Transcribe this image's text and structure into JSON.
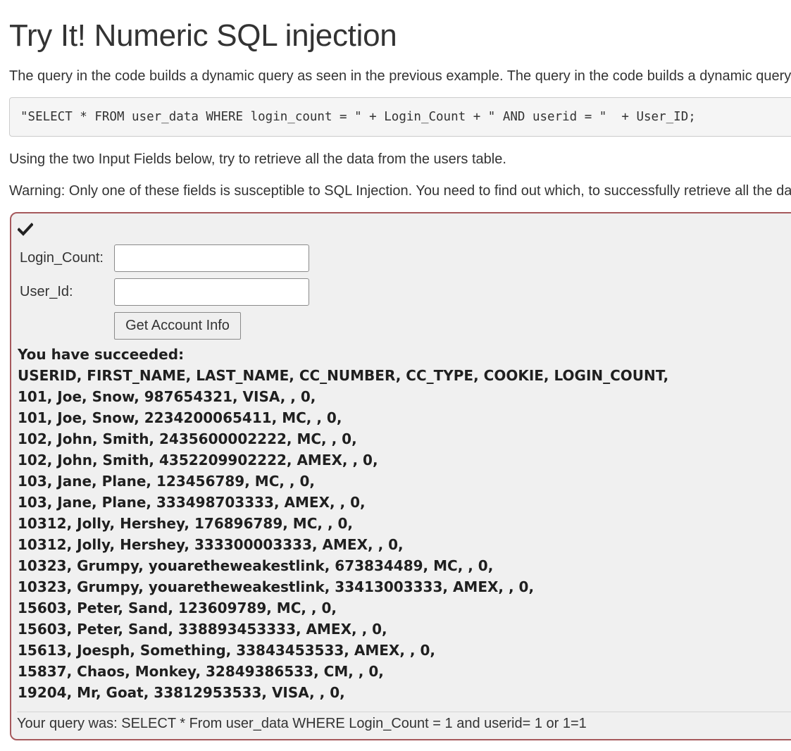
{
  "page": {
    "title": "Try It! Numeric SQL injection",
    "intro": "The query in the code builds a dynamic query as seen in the previous example. The query in the code builds a dynamic query as seen in the previous example.",
    "code": "\"SELECT * FROM user_data WHERE login_count = \" + Login_Count + \" AND userid = \"  + User_ID;",
    "instruction": "Using the two Input Fields below, try to retrieve all the data from the users table.",
    "warning": "Warning: Only one of these fields is susceptible to SQL Injection. You need to find out which, to successfully retrieve all the data."
  },
  "form": {
    "status_icon": "check-icon",
    "login_count_label": "Login_Count:",
    "login_count_value": "",
    "user_id_label": "User_Id:",
    "user_id_value": "",
    "submit_label": "Get Account Info"
  },
  "result": {
    "heading": "You have succeeded:",
    "lines": [
      "USERID, FIRST_NAME, LAST_NAME, CC_NUMBER, CC_TYPE, COOKIE, LOGIN_COUNT,",
      "101, Joe, Snow, 987654321, VISA, , 0,",
      "101, Joe, Snow, 2234200065411, MC, , 0,",
      "102, John, Smith, 2435600002222, MC, , 0,",
      "102, John, Smith, 4352209902222, AMEX, , 0,",
      "103, Jane, Plane, 123456789, MC, , 0,",
      "103, Jane, Plane, 333498703333, AMEX, , 0,",
      "10312, Jolly, Hershey, 176896789, MC, , 0,",
      "10312, Jolly, Hershey, 333300003333, AMEX, , 0,",
      "10323, Grumpy, youaretheweakestlink, 673834489, MC, , 0,",
      "10323, Grumpy, youaretheweakestlink, 33413003333, AMEX, , 0,",
      "15603, Peter, Sand, 123609789, MC, , 0,",
      "15603, Peter, Sand, 338893453333, AMEX, , 0,",
      "15613, Joesph, Something, 33843453533, AMEX, , 0,",
      "15837, Chaos, Monkey, 32849386533, CM, , 0,",
      "19204, Mr, Goat, 33812953533, VISA, , 0,"
    ],
    "query_text": "Your query was: SELECT * From user_data WHERE Login_Count = 1 and userid= 1 or 1=1"
  },
  "colors": {
    "box_border": "#a6595c",
    "box_background": "#f0f0f0",
    "code_background": "#f5f5f5"
  }
}
